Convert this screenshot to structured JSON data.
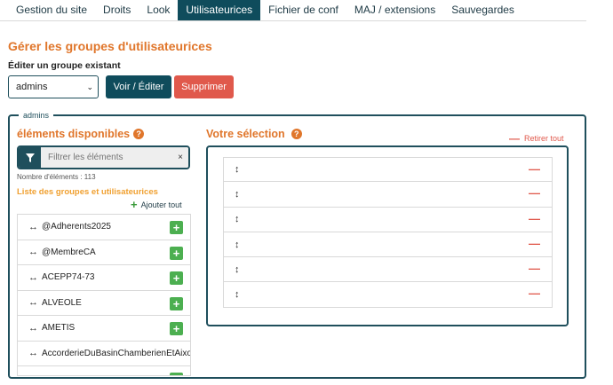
{
  "tabs": [
    {
      "label": "Gestion du site",
      "active": false
    },
    {
      "label": "Droits",
      "active": false
    },
    {
      "label": "Look",
      "active": false
    },
    {
      "label": "Utilisateurices",
      "active": true
    },
    {
      "label": "Fichier de conf",
      "active": false
    },
    {
      "label": "MAJ / extensions",
      "active": false
    },
    {
      "label": "Sauvegardes",
      "active": false
    }
  ],
  "page_title": "Gérer les groupes d'utilisateurices",
  "edit_label": "Éditer un groupe existant",
  "group_select": {
    "value": "admins"
  },
  "buttons": {
    "view_edit": "Voir / Éditer",
    "delete": "Supprimer"
  },
  "fieldset": {
    "legend": "admins"
  },
  "available": {
    "title": "éléments disponibles",
    "filter_placeholder": "Filtrer les éléments",
    "clear_label": "×",
    "count_text": "Nombre d'éléments : 113",
    "list_title": "Liste des groupes et utilisateurices",
    "add_all_label": "Ajouter tout",
    "items": [
      {
        "label": "@Adherents2025"
      },
      {
        "label": "@MembreCA"
      },
      {
        "label": "ACEPP74-73"
      },
      {
        "label": "ALVEOLE"
      },
      {
        "label": "AMETIS"
      },
      {
        "label": "AccorderieDuBasinChamberienEtAixois"
      }
    ]
  },
  "selection": {
    "title": "Votre sélection",
    "remove_all_label": "Retirer tout",
    "rows": 6
  },
  "icons": {
    "help": "question-circle-icon",
    "filter": "filter-icon",
    "drag": "vertical-arrows-icon",
    "move": "horizontal-arrows-icon",
    "add": "plus-icon",
    "remove": "minus-icon"
  },
  "colors": {
    "primary": "#0f4c5c",
    "accent": "#e0762b",
    "danger": "#e0594c",
    "success": "#4caf50",
    "list_title": "#f0a030"
  }
}
